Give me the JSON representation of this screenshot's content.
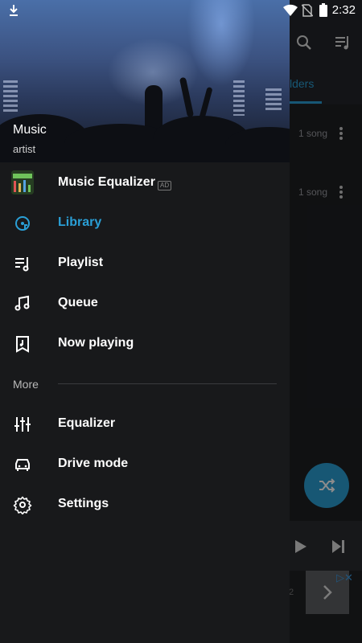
{
  "status_bar": {
    "time": "2:32"
  },
  "background_app": {
    "tab_label": "lders",
    "rows": [
      {
        "count": "1 song"
      },
      {
        "count": "1 song"
      }
    ],
    "ad_text": "2"
  },
  "drawer": {
    "header": {
      "title": "Music",
      "subtitle": "artist"
    },
    "promo": {
      "label": "Music Equalizer",
      "badge": "AD"
    },
    "items": [
      {
        "label": "Library",
        "icon": "library-icon",
        "active": true
      },
      {
        "label": "Playlist",
        "icon": "playlist-icon"
      },
      {
        "label": "Queue",
        "icon": "queue-icon"
      },
      {
        "label": "Now playing",
        "icon": "now-playing-icon"
      }
    ],
    "section_label": "More",
    "more_items": [
      {
        "label": "Equalizer",
        "icon": "equalizer-icon"
      },
      {
        "label": "Drive mode",
        "icon": "car-icon"
      },
      {
        "label": "Settings",
        "icon": "gear-icon"
      }
    ]
  },
  "colors": {
    "accent": "#2a9fd6",
    "drawer_bg": "#18191b",
    "text": "#ffffff"
  }
}
